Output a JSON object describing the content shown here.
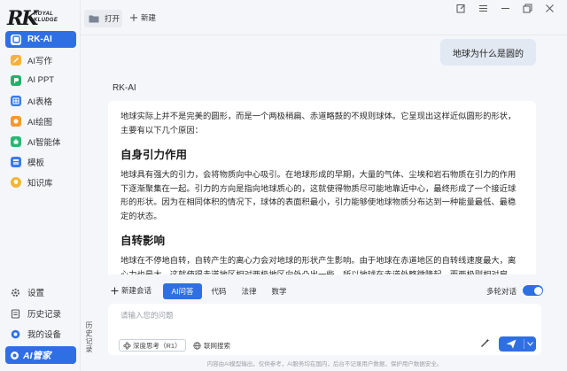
{
  "brand": {
    "logo_main": "RK",
    "logo_sub_1": "ROYAL",
    "logo_sub_2": "KLUDGE"
  },
  "sidebar": {
    "items": [
      {
        "label": "RK-AI",
        "icon": "rk-ai-icon",
        "color": "#2f6fe4",
        "active": true
      },
      {
        "label": "AI写作",
        "icon": "writing-icon",
        "color": "#f2b53a"
      },
      {
        "label": "AI PPT",
        "icon": "ppt-icon",
        "color": "#21b26b"
      },
      {
        "label": "AI表格",
        "icon": "table-icon",
        "color": "#3b7bf0"
      },
      {
        "label": "AI绘图",
        "icon": "paint-icon",
        "color": "#f29a2e"
      },
      {
        "label": "AI智能体",
        "icon": "agent-icon",
        "color": "#2bb673"
      },
      {
        "label": "模板",
        "icon": "template-icon",
        "color": "#3b7bf0"
      },
      {
        "label": "知识库",
        "icon": "knowledge-icon",
        "color": "#f2b53a"
      }
    ],
    "bottom": [
      {
        "label": "设置",
        "icon": "gear-icon"
      },
      {
        "label": "历史记录",
        "icon": "history-icon"
      },
      {
        "label": "我的设备",
        "icon": "device-icon"
      }
    ],
    "brand_pill": "AI管家"
  },
  "history_strip": "历史记录",
  "topbar": {
    "open_label": "打开",
    "new_label": "新建"
  },
  "chat": {
    "user_message": "地球为什么是圆的",
    "bot_name": "RK-AI",
    "answer": {
      "intro": "地球实际上并不是完美的圆形，而是一个两极稍扁、赤道略鼓的不规则球体。它呈现出这样近似圆形的形状，主要有以下几个原因：",
      "h1": "自身引力作用",
      "p1": "地球具有强大的引力，会将物质向中心吸引。在地球形成的早期，大量的气体、尘埃和岩石物质在引力的作用下逐渐聚集在一起。引力的方向是指向地球质心的，这就使得物质尽可能地靠近中心，最终形成了一个接近球形的形状。因为在相同体积的情况下，球体的表面积最小，引力能够使地球物质分布达到一种能量最低、最稳定的状态。",
      "h2": "自转影响",
      "p2": "地球在不停地自转，自转产生的离心力会对地球的形状产生影响。由于地球在赤道地区的自转线速度最大，离心力也最大，这就使得赤道地区相对两极地区向外凸出一些。所以地球在赤道处略微隆起，而两极则相对扁"
    }
  },
  "toolbar": {
    "new_chat": "新建会话",
    "modes": [
      "AI问答",
      "代码",
      "法律",
      "数学"
    ],
    "active_mode": "AI问答",
    "multi_turn_label": "多轮对话",
    "multi_turn_on": true
  },
  "input": {
    "placeholder": "请输入您的问题",
    "deep_think": "深度思考（R1）",
    "web_search": "联网搜索"
  },
  "disclaimer": "内容由AI模型输出，仅供参考，AI服务均在国内，后台不记录用户数据，保护用户数据安全。"
}
